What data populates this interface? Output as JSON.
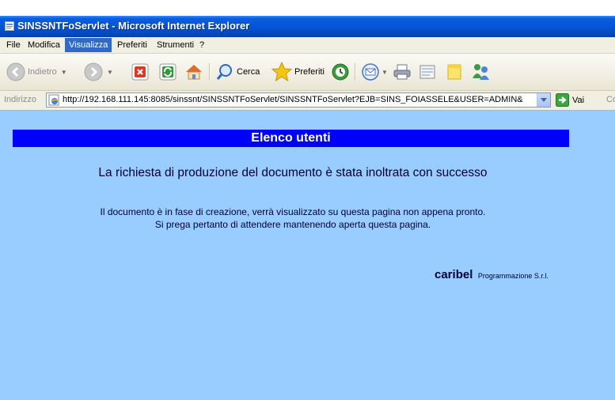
{
  "window": {
    "title": "SINSSNTFoServlet - Microsoft Internet Explorer"
  },
  "menu": {
    "items": [
      "File",
      "Modifica",
      "Visualizza",
      "Preferiti",
      "Strumenti",
      "?"
    ],
    "active_index": 2
  },
  "toolbar": {
    "back_label": "Indietro",
    "search_label": "Cerca",
    "favorites_label": "Preferiti"
  },
  "address": {
    "label": "Indirizzo",
    "url": "http://192.168.111.145:8085/sinssnt/SINSSNTFoServlet/SINSSNTFoServlet?EJB=SINS_FOIASSELE&USER=ADMIN&",
    "go_label": "Vai",
    "links_cut": "Co"
  },
  "page": {
    "banner": "Elenco utenti",
    "heading": "La richiesta di produzione del documento è stata inoltrata con successo",
    "line1": "Il documento è in fase di creazione, verrà visualizzato su questa pagina non appena pronto.",
    "line2": "Si prega pertanto di attendere mantenendo aperta questa pagina.",
    "brand_name": "caribel",
    "brand_sub": "Programmazione S.r.l."
  },
  "colors": {
    "page_background": "#99ccff",
    "banner_background": "#0000ff",
    "titlebar": "#0454d6"
  }
}
